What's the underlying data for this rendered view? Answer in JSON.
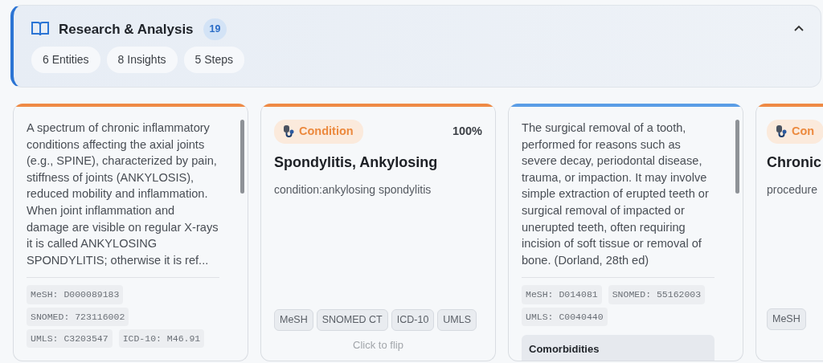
{
  "header": {
    "title": "Research & Analysis",
    "count": "19",
    "expanded": true,
    "chips": [
      "6 Entities",
      "8 Insights",
      "5 Steps"
    ]
  },
  "cards": [
    {
      "kind": "back",
      "color": "#ef8a45",
      "description": "A spectrum of chronic inflammatory conditions affecting the axial joints (e.g., SPINE), characterized by pain, stiffness of joints (ANKYLOSIS), reduced mobility and inflammation. When joint inflammation and damage are visible on regular X-rays it is called ANKYLOSING SPONDYLITIS; otherwise it is ref...",
      "codes": [
        "MeSH: D000089183",
        "SNOMED: 723116002",
        "UMLS: C3203547",
        "ICD-10: M46.91"
      ]
    },
    {
      "kind": "front",
      "color": "#ef8a45",
      "badge": "Condition",
      "score": "100%",
      "title": "Spondylitis, Ankylosing",
      "subtitle": "condition:ankylosing spondylitis",
      "sources": [
        "MeSH",
        "SNOMED CT",
        "ICD-10",
        "UMLS"
      ],
      "hint": "Click to flip"
    },
    {
      "kind": "back",
      "color": "#5a9de6",
      "description": "The surgical removal of a tooth, performed for reasons such as severe decay, periodontal disease, trauma, or impaction. It may involve simple extraction of erupted teeth or surgical removal of impacted or unerupted teeth, often requiring incision of soft tissue or removal of bone. (Dorland, 28th ed)",
      "codes": [
        "MeSH: D014081",
        "SNOMED: 55162003",
        "UMLS: C0040440"
      ],
      "section": "Comorbidities"
    },
    {
      "kind": "front",
      "color": "#ef8a45",
      "badge": "Con",
      "title": "Chronic",
      "subtitle": "procedure",
      "sources": [
        "MeSH"
      ]
    }
  ]
}
